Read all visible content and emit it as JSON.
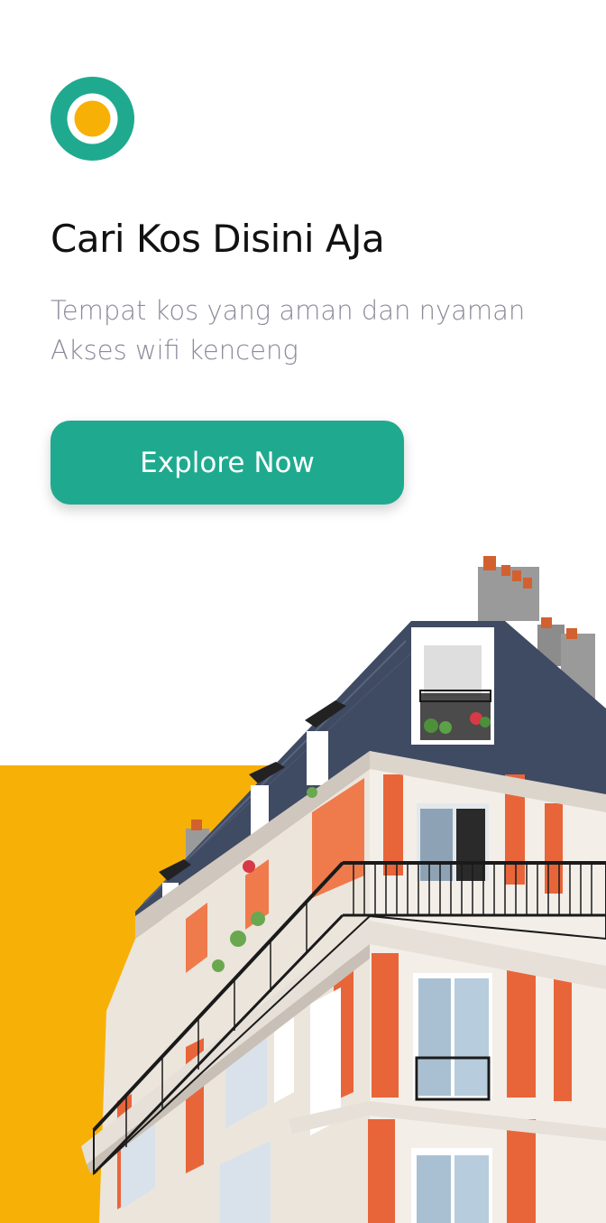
{
  "logo": {
    "icon": "circle-logo-icon",
    "outer_color": "#1faa8f",
    "inner_color": "#f7b106"
  },
  "hero": {
    "title": "Cari Kos Disini AJa",
    "subtitle_lines": [
      "Tempat kos yang aman dan nyaman",
      "Akses wifi kenceng"
    ]
  },
  "cta": {
    "label": "Explore Now",
    "color": "#1faa8f"
  },
  "illustration": {
    "icon": "apartment-building-image",
    "accent_color": "#f7b106"
  }
}
